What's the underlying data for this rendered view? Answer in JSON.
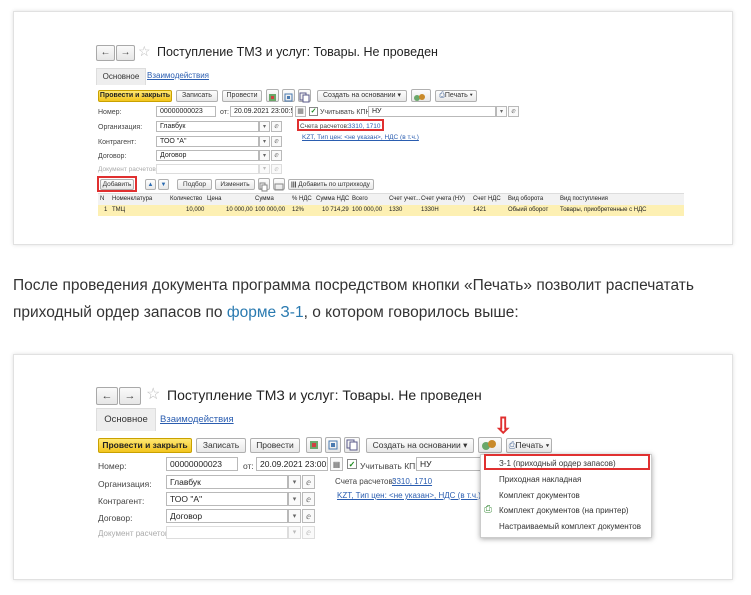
{
  "window": {
    "nav_back": "←",
    "nav_forward": "→",
    "star": "☆",
    "title": "Поступление ТМЗ и услуг: Товары. Не проведен"
  },
  "tabs": {
    "main": "Основное",
    "interactions": "Взаимодействия"
  },
  "toolbar": {
    "post_close": "Провести и закрыть",
    "save": "Записать",
    "post": "Провести",
    "create_based": "Создать на основании ▾",
    "print": "Печать ▾"
  },
  "form": {
    "number_label": "Номер:",
    "number_value": "00000000023",
    "date_label": "от:",
    "date_value": "20.09.2021 23:00:58",
    "kpn_label": "Учитывать КПН",
    "kpn_value": "НУ",
    "org_label": "Организация:",
    "org_value": "Главбук",
    "contractor_label": "Контрагент:",
    "contractor_value": "ТОО \"А\"",
    "contract_label": "Договор:",
    "contract_value": "Договор",
    "doc_label": "Документ расчетов:",
    "accounts_label": "Счета расчетов:",
    "accounts_value": "3310, 1710",
    "kzt_link": "KZT, Тип цен: <не указан>, НДС (в т.ч.)"
  },
  "table_toolbar": {
    "add": "Добавить",
    "up": "▲",
    "down": "▼",
    "select": "Подбор",
    "change": "Изменить",
    "barcode": "Добавить по штрихкоду"
  },
  "table": {
    "columns": [
      "N",
      "Номенклатура",
      "Количество",
      "Цена",
      "Сумма",
      "% НДС",
      "Сумма НДС",
      "Всего",
      "Счет учет...",
      "Счет учета (НУ)",
      "Счет НДС",
      "Вид оборота",
      "Вид поступления"
    ],
    "rows": [
      [
        "1",
        "ТМЦ",
        "10,000",
        "10 000,00",
        "100 000,00",
        "12%",
        "10 714,29",
        "100 000,00",
        "1330",
        "1330Н",
        "1421",
        "Обыий оборот",
        "Товары, приобретенные с НДС"
      ]
    ]
  },
  "paragraph": {
    "before": "После проведения документа программа посредством кнопки «Печать» позволит распечатать приходный ордер запасов по ",
    "link": "форме З-1",
    "after": ", о котором говорилось выше:"
  },
  "print_menu": {
    "arrow": "⇩",
    "items": [
      "З-1 (приходный ордер запасов)",
      "Приходная накладная",
      "Комплект документов",
      "Комплект документов (на принтер)",
      "Настраиваемый комплект документов"
    ]
  },
  "colors": {
    "highlight": "#e03030",
    "primary_button": "#f3c51e",
    "link": "#2a5db0",
    "row_selected": "#fdf0b3"
  }
}
